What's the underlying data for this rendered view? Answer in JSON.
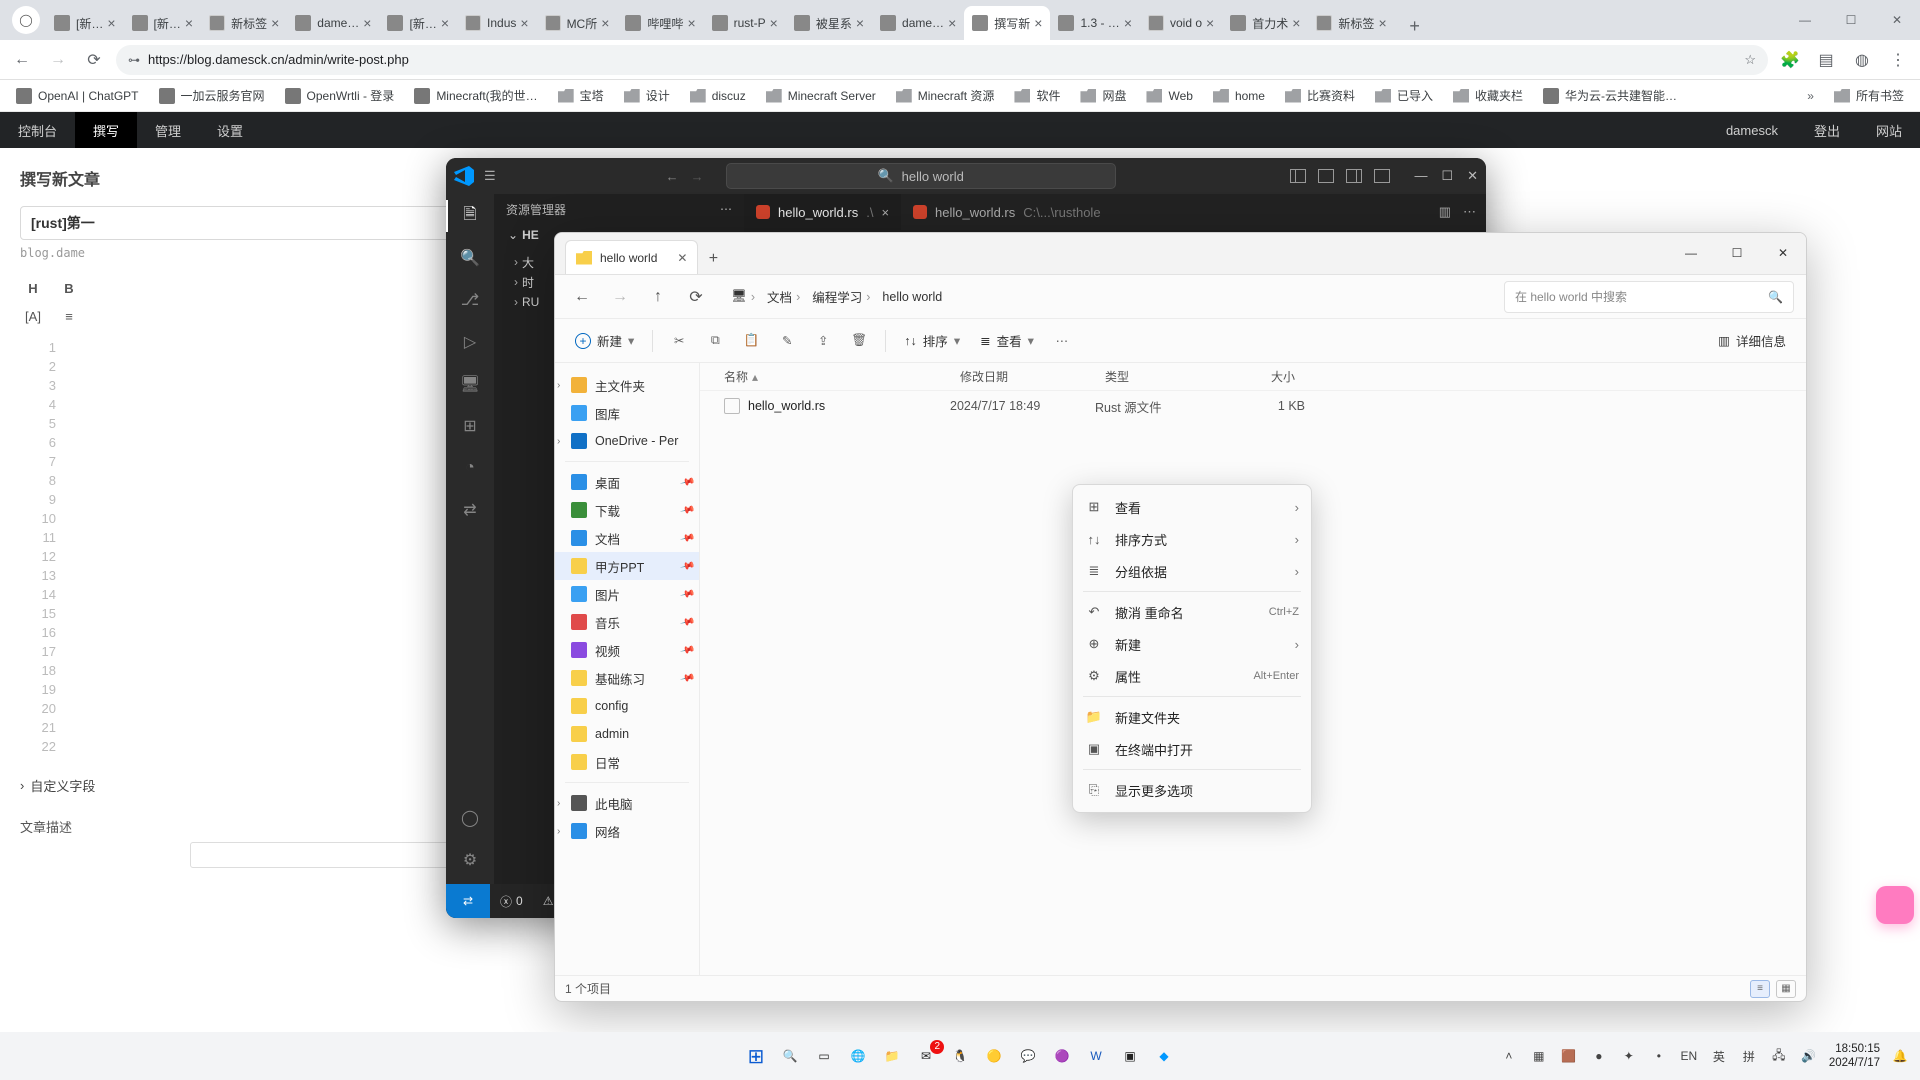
{
  "chrome": {
    "tabs": [
      {
        "title": "[新…",
        "fav": "ic-mc"
      },
      {
        "title": "[新…",
        "fav": "ic-mc"
      },
      {
        "title": "新标签",
        "fav": "ic-chrome"
      },
      {
        "title": "dame…",
        "fav": "ic-mc"
      },
      {
        "title": "[新…",
        "fav": "ic-mc"
      },
      {
        "title": "Indus",
        "fav": "ic-chrome"
      },
      {
        "title": "MC所",
        "fav": "ic-chrome"
      },
      {
        "title": "哔哩哔",
        "fav": "ic-bili"
      },
      {
        "title": "rust-P",
        "fav": "ic-bili"
      },
      {
        "title": "被星系",
        "fav": "ic-bili"
      },
      {
        "title": "dame…",
        "fav": "ic-generic"
      },
      {
        "title": "撰写新",
        "fav": "ic-generic",
        "active": true
      },
      {
        "title": "1.3 - …",
        "fav": "ic-bili"
      },
      {
        "title": "void o",
        "fav": "ic-chrome"
      },
      {
        "title": "首力术",
        "fav": "ic-generic"
      },
      {
        "title": "新标签",
        "fav": "ic-chrome"
      }
    ],
    "url": "https://blog.damesck.cn/admin/write-post.php",
    "bookmarks": [
      {
        "label": "OpenAI | ChatGPT",
        "ic": "ic-chatgpt",
        "folder": false
      },
      {
        "label": "一加云服务官网",
        "ic": "ic-oneplus",
        "folder": false
      },
      {
        "label": "OpenWrtli - 登录",
        "ic": "ic-openwrt",
        "folder": false
      },
      {
        "label": "Minecraft(我的世…",
        "ic": "ic-mc",
        "folder": false
      },
      {
        "label": "宝塔",
        "folder": true
      },
      {
        "label": "设计",
        "folder": true
      },
      {
        "label": "discuz",
        "folder": true
      },
      {
        "label": "Minecraft Server",
        "folder": true
      },
      {
        "label": "Minecraft 资源",
        "folder": true
      },
      {
        "label": "软件",
        "folder": true
      },
      {
        "label": "网盘",
        "folder": true
      },
      {
        "label": "Web",
        "folder": true
      },
      {
        "label": "home",
        "folder": true
      },
      {
        "label": "比赛资料",
        "folder": true
      },
      {
        "label": "已导入",
        "folder": true
      },
      {
        "label": "收藏夹栏",
        "folder": true
      },
      {
        "label": "华为云-云共建智能…",
        "ic": "ic-huawei",
        "folder": false
      }
    ],
    "all_bookmarks": "所有书签"
  },
  "admin": {
    "topnav": [
      "控制台",
      "撰写",
      "管理",
      "设置"
    ],
    "topnav_active": 1,
    "user": "damesck",
    "logout": "登出",
    "site": "网站",
    "heading": "撰写新文章",
    "title_value": "[rust]第一",
    "permalink": "blog.dame",
    "toolbar_items": [
      "H",
      "B"
    ],
    "toolbar_items2": [
      "[A]",
      "≡"
    ],
    "line_count": 22,
    "custom_fields": "自定义字段",
    "section_below": "文章描述"
  },
  "vscode": {
    "search_text": "hello world",
    "sidebar_title": "资源管理器",
    "folder_label": "HE",
    "tabs": [
      {
        "name": "hello_world.rs",
        "sub": ".\\",
        "active": true
      },
      {
        "name": "hello_world.rs",
        "sub": "C:\\...\\rusthole",
        "active": false
      }
    ],
    "tree": [
      {
        "label": "大"
      },
      {
        "label": "时"
      },
      {
        "label": "RU"
      }
    ],
    "status_left": "0",
    "status_warn": "⚠"
  },
  "explorer": {
    "tab_title": "hello world",
    "breadcrumb": [
      "文档",
      "编程学习",
      "hello world"
    ],
    "search_placeholder": "在 hello world 中搜索",
    "toolbar": {
      "new": "新建",
      "sort": "排序",
      "view": "查看",
      "details": "详细信息"
    },
    "columns": {
      "name": "名称",
      "date": "修改日期",
      "type": "类型",
      "size": "大小"
    },
    "files": [
      {
        "name": "hello_world.rs",
        "date": "2024/7/17 18:49",
        "type": "Rust 源文件",
        "size": "1 KB"
      }
    ],
    "nav": [
      {
        "label": "主文件夹",
        "ic": "nico-home",
        "chev": true
      },
      {
        "label": "图库",
        "ic": "nico-gallery"
      },
      {
        "label": "OneDrive - Per",
        "ic": "nico-onedrive",
        "chev": true
      },
      {
        "divider": true
      },
      {
        "label": "桌面",
        "ic": "nico-desk",
        "pin": true
      },
      {
        "label": "下载",
        "ic": "nico-down",
        "pin": true
      },
      {
        "label": "文档",
        "ic": "nico-docs",
        "pin": true
      },
      {
        "label": "甲方PPT",
        "ic": "nico-folder",
        "pin": true,
        "selected": true
      },
      {
        "label": "图片",
        "ic": "nico-pic",
        "pin": true
      },
      {
        "label": "音乐",
        "ic": "nico-music",
        "pin": true
      },
      {
        "label": "视频",
        "ic": "nico-video",
        "pin": true
      },
      {
        "label": "基础练习",
        "ic": "nico-folder",
        "pin": true
      },
      {
        "label": "config",
        "ic": "nico-folder"
      },
      {
        "label": "admin",
        "ic": "nico-folder"
      },
      {
        "label": "日常",
        "ic": "nico-folder"
      },
      {
        "divider": true
      },
      {
        "label": "此电脑",
        "ic": "nico-pc",
        "chev": true
      },
      {
        "label": "网络",
        "ic": "nico-net",
        "chev": true
      }
    ],
    "status": "1 个项目"
  },
  "context_menu": [
    {
      "icon": "⊞",
      "label": "查看",
      "sub": true
    },
    {
      "icon": "↑↓",
      "label": "排序方式",
      "sub": true
    },
    {
      "icon": "≣",
      "label": "分组依据",
      "sub": true
    },
    {
      "sep": true
    },
    {
      "icon": "↶",
      "label": "撤消 重命名",
      "kb": "Ctrl+Z"
    },
    {
      "icon": "⊕",
      "label": "新建",
      "sub": true
    },
    {
      "icon": "⚙",
      "label": "属性",
      "kb": "Alt+Enter"
    },
    {
      "sep": true
    },
    {
      "icon": "📁",
      "label": "新建文件夹"
    },
    {
      "icon": "▣",
      "label": "在终端中打开"
    },
    {
      "sep": true
    },
    {
      "icon": "⎘",
      "label": "显示更多选项"
    }
  ],
  "tray": {
    "ime1": "EN",
    "ime2": "英",
    "ime3": "拼",
    "time": "18:50:15",
    "date": "2024/7/17"
  }
}
